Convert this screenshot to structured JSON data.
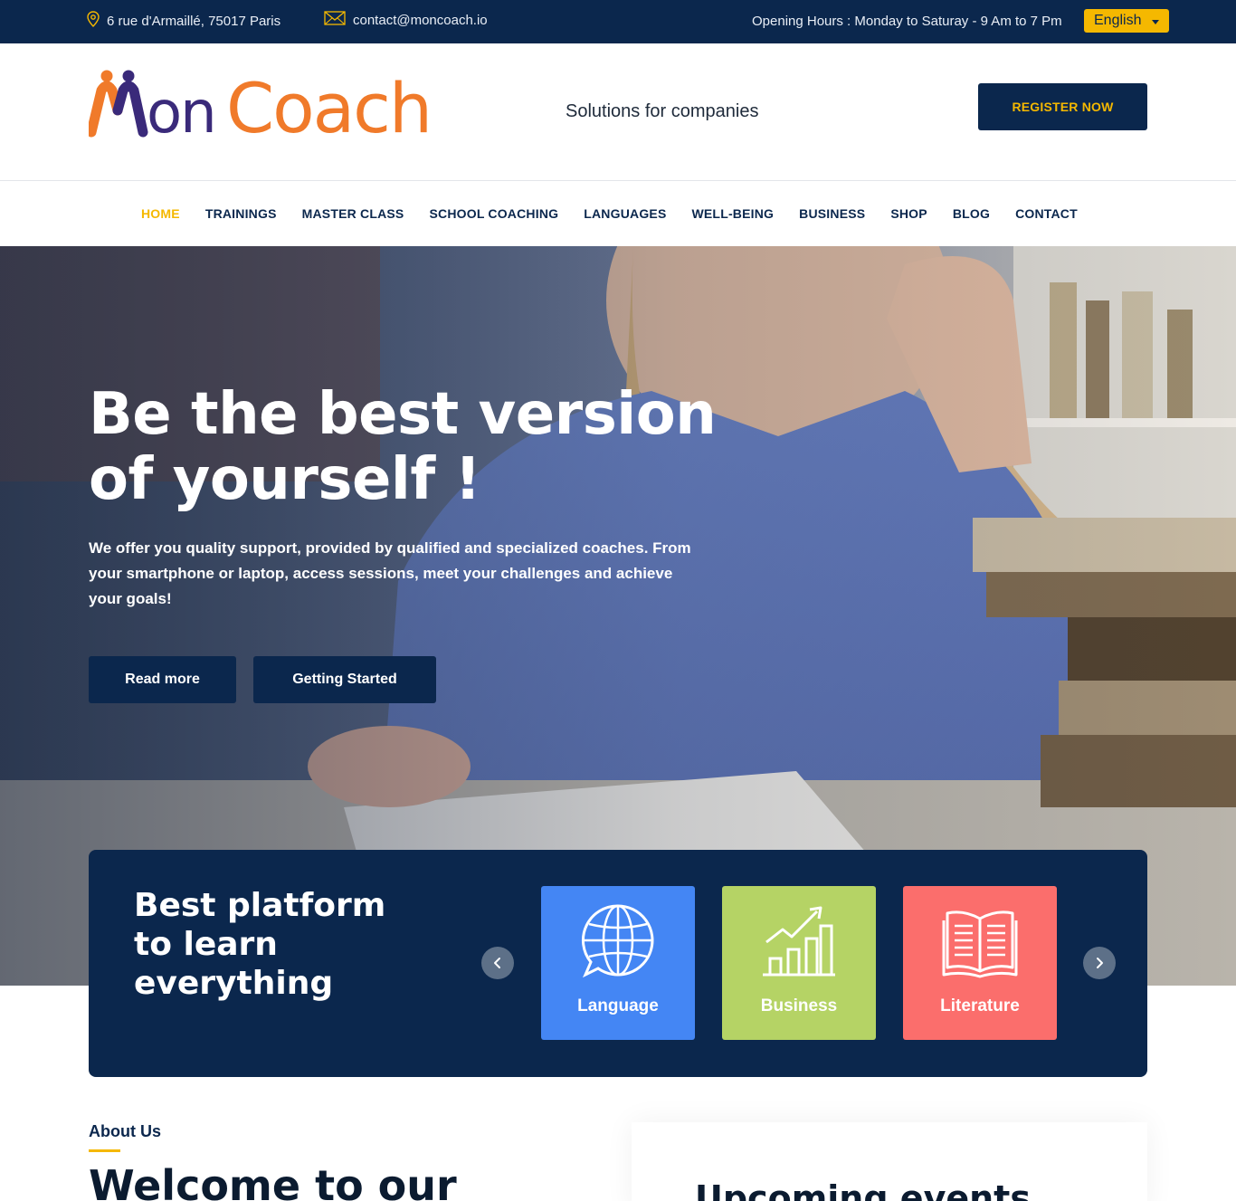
{
  "topbar": {
    "address": "6 rue d'Armaillé, 75017 Paris",
    "email": "contact@moncoach.io",
    "hours": "Opening Hours : Monday to Saturay - 9 Am to 7 Pm",
    "language": "English"
  },
  "header": {
    "logo": "MonCoach",
    "tagline": "Solutions for companies",
    "register_label": "REGISTER NOW"
  },
  "nav": {
    "items": [
      "HOME",
      "TRAININGS",
      "MASTER CLASS",
      "SCHOOL COACHING",
      "LANGUAGES",
      "WELL-BEING",
      "BUSINESS",
      "SHOP",
      "BLOG",
      "CONTACT"
    ],
    "active": "HOME"
  },
  "hero": {
    "title": "Be the best version of yourself !",
    "text": "We offer you quality support, provided by qualified and specialized coaches. From your smartphone or laptop, access sessions, meet your challenges and achieve your goals!",
    "read_more": "Read more",
    "getting_started": "Getting Started"
  },
  "platform": {
    "title": "Best platform to learn everything",
    "cards": [
      {
        "label": "Language",
        "icon": "globe-chat-icon",
        "color": "#4486f4"
      },
      {
        "label": "Business",
        "icon": "growth-chart-icon",
        "color": "#b5d365"
      },
      {
        "label": "Literature",
        "icon": "open-book-icon",
        "color": "#fb6e6c"
      }
    ]
  },
  "about": {
    "label": "About Us",
    "heading": "Welcome to our"
  },
  "events": {
    "heading": "Upcoming events"
  },
  "colors": {
    "navy": "#0b274d",
    "accent": "#f5b800",
    "logo_orange": "#f07a2a",
    "logo_purple": "#3a2a7a"
  }
}
